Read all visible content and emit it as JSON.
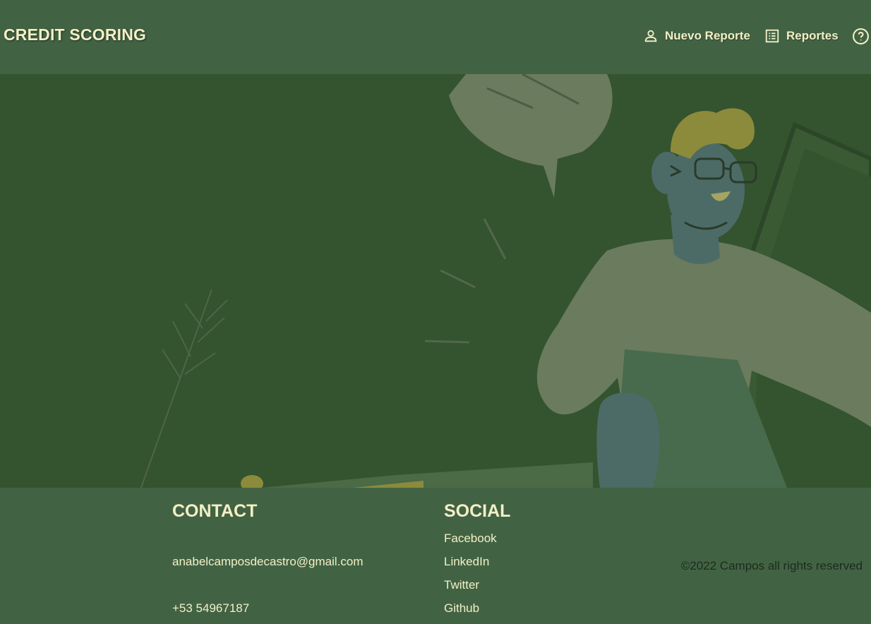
{
  "header": {
    "brand": "CREDIT SCORING",
    "nav": [
      {
        "label": "Nuevo Reporte",
        "icon": "person-icon"
      },
      {
        "label": "Reportes",
        "icon": "list-icon"
      }
    ],
    "help_icon": "help-icon"
  },
  "footer": {
    "contact": {
      "title": "CONTACT",
      "email": "anabelcamposdecastro@gmail.com",
      "phone": "+53 54967187"
    },
    "social": {
      "title": "SOCIAL",
      "links": [
        "Facebook",
        "LinkedIn",
        "Twitter",
        "Github"
      ]
    },
    "copyright": "©2022 Campos all rights reserved"
  },
  "colors": {
    "header_bg": "#416344",
    "hero_bg": "#34532f",
    "text": "#f4efc6"
  }
}
